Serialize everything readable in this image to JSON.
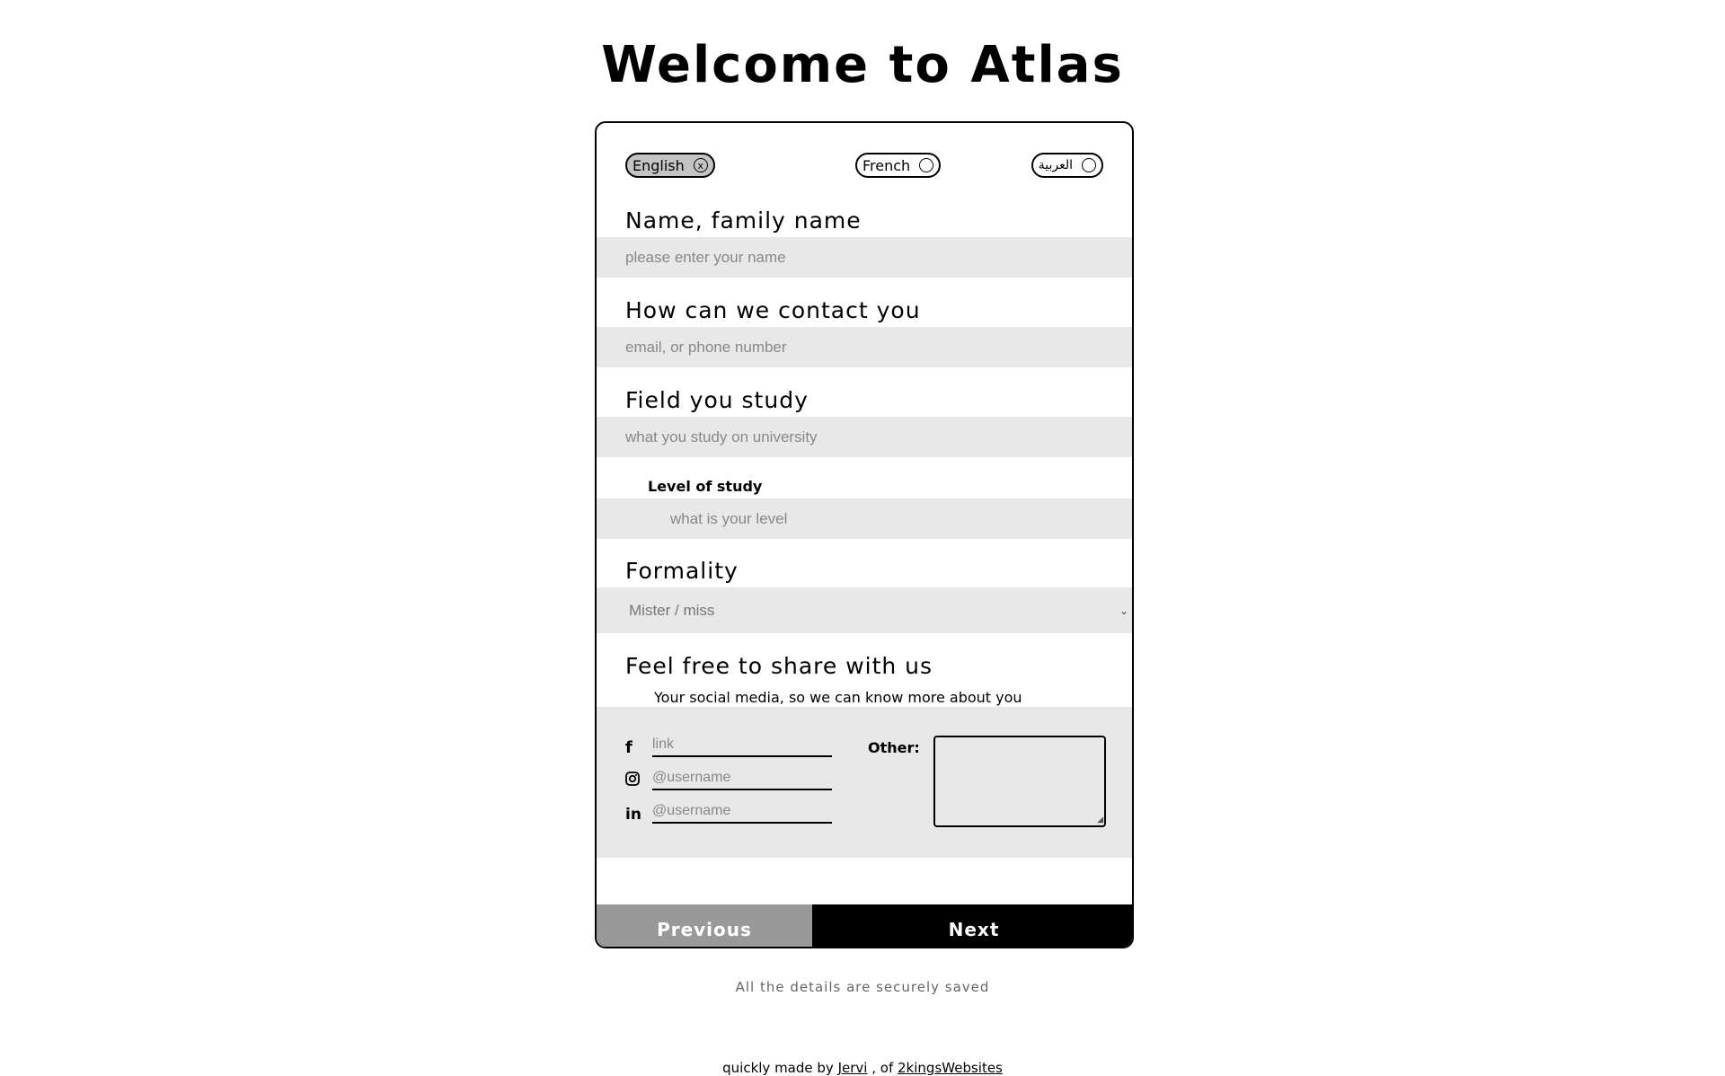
{
  "page": {
    "title": "Welcome to Atlas"
  },
  "languages": [
    {
      "label": "English",
      "selected": true,
      "marker": "x"
    },
    {
      "label": "French",
      "selected": false,
      "marker": ""
    },
    {
      "label": "العربية",
      "selected": false,
      "marker": ""
    }
  ],
  "form": {
    "name": {
      "label": "Name, family name",
      "placeholder": "please enter your name"
    },
    "contact": {
      "label": "How can we contact you",
      "placeholder": "email, or phone number"
    },
    "field": {
      "label": "Field you study",
      "placeholder": "what you study on university"
    },
    "level": {
      "label": "Level of study",
      "placeholder": "what is your level"
    },
    "formality": {
      "label": "Formality",
      "selected": "Mister / miss"
    },
    "share": {
      "label": "Feel free to share with us",
      "caption": "Your social media, so we can know more about you",
      "facebook": {
        "icon": "facebook-icon",
        "placeholder": "link"
      },
      "instagram": {
        "icon": "instagram-icon",
        "placeholder": "@username"
      },
      "linkedin": {
        "icon": "linkedin-icon",
        "placeholder": "@username"
      },
      "other_label": "Other:"
    }
  },
  "buttons": {
    "previous": "Previous",
    "next": "Next"
  },
  "secure_note": "All the details are securely saved",
  "footer": {
    "prefix": "quickly made by",
    "author": "Jervi",
    "middle": ", of",
    "company": "2kingsWebsites"
  },
  "colors": {
    "active_lang": "#c4c4c4",
    "field_bg": "#e8e8e8",
    "prev_btn": "#999999",
    "next_btn": "#000000"
  }
}
